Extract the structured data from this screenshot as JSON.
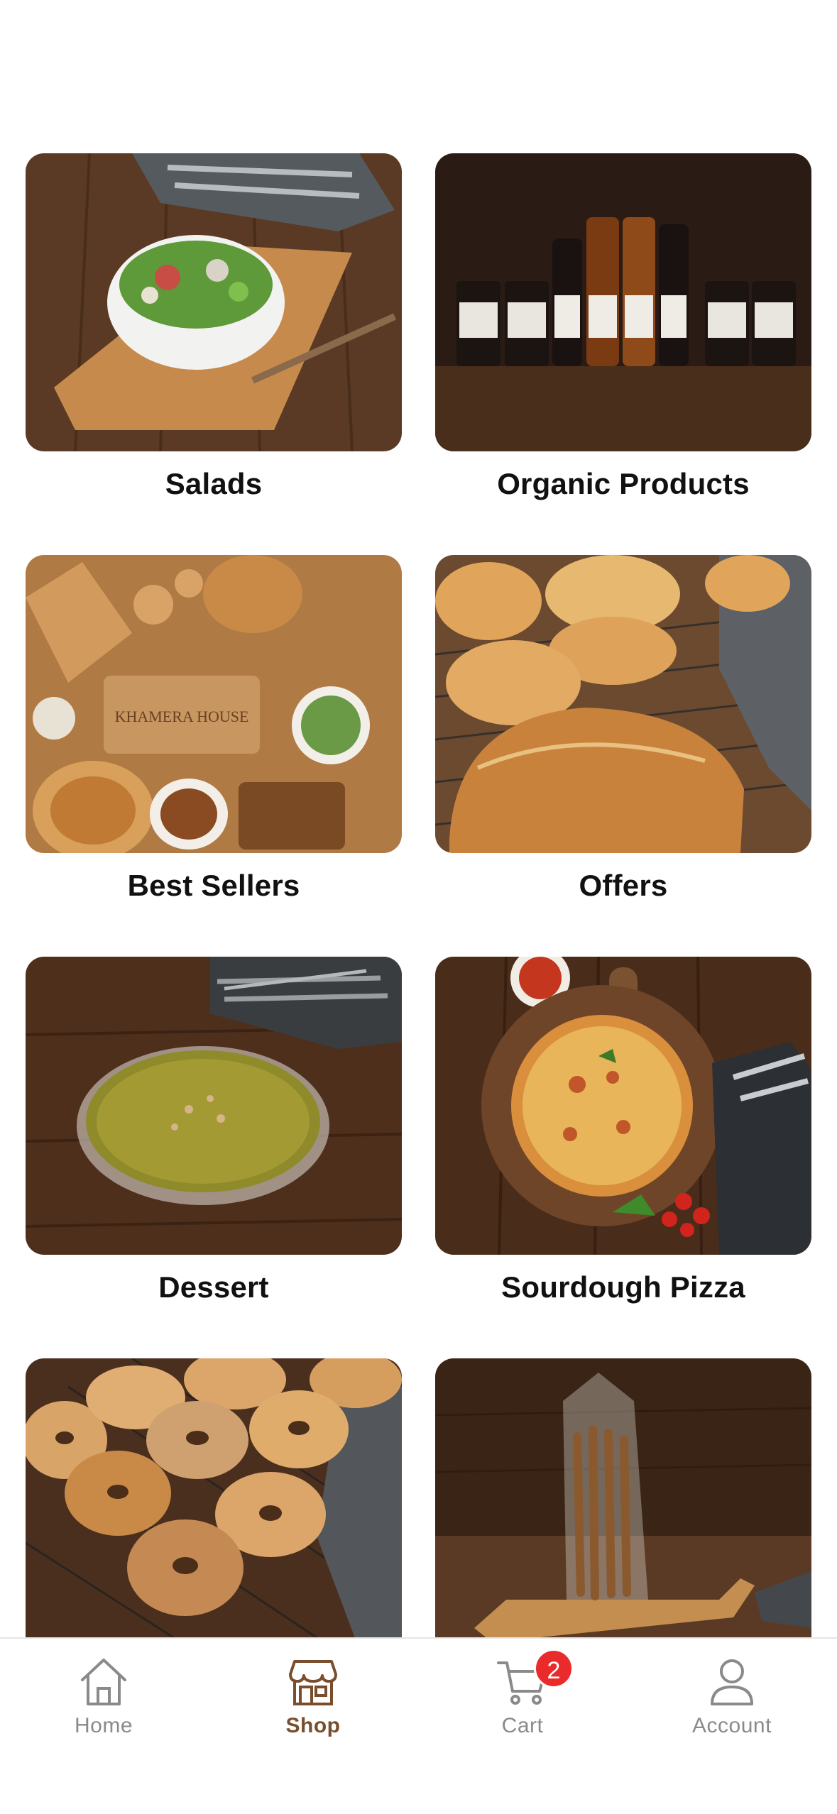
{
  "categories": [
    {
      "label": "Salads",
      "image": "salad bowl on wooden board"
    },
    {
      "label": "Organic Products",
      "image": "bottles and jars on wooden table"
    },
    {
      "label": "Best Sellers",
      "image": "bakery assortment flat lay"
    },
    {
      "label": "Offers",
      "image": "bagels and sourdough loaf on rack"
    },
    {
      "label": "Dessert",
      "image": "pistachio pie on wooden table"
    },
    {
      "label": "Sourdough Pizza",
      "image": "pizza on wooden board"
    },
    {
      "label": "",
      "image": "sesame and poppy bagels on rack"
    },
    {
      "label": "",
      "image": "breadsticks bag on wooden board"
    }
  ],
  "tabbar": {
    "home_label": "Home",
    "shop_label": "Shop",
    "cart_label": "Cart",
    "cart_badge": "2",
    "account_label": "Account",
    "active_tab": "Shop",
    "active_color": "#7a4e2d",
    "inactive_color": "#8a8a8a",
    "badge_color": "#ea2b2b"
  }
}
